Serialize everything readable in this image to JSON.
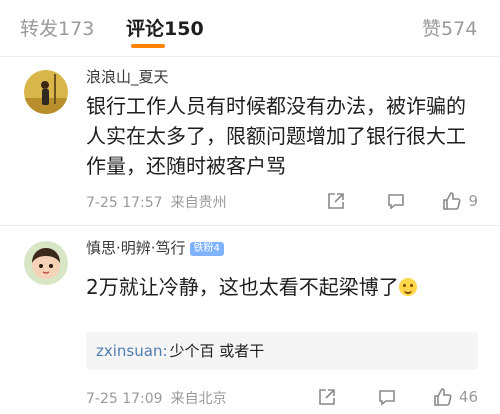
{
  "tabs": [
    {
      "label": "转发",
      "count": "173",
      "active": false
    },
    {
      "label": "评论",
      "count": "150",
      "active": true
    },
    {
      "label": "赞",
      "count": "574",
      "active": false
    }
  ],
  "comments": [
    {
      "username": "浪浪山_夏天",
      "text": "银行工作人员有时候都没有办法，被诈骗的人实在太多了，限额问题增加了银行很大工作量，还随时被客户骂",
      "time": "7-25 17:57",
      "location": "来自贵州",
      "likes": "9"
    },
    {
      "username": "慎思·明辨·笃行",
      "badge": "铁粉4",
      "text": "2万就让冷静，这也太看不起梁博了",
      "time": "7-25 17:09",
      "location": "来自北京",
      "likes": "46",
      "reply": {
        "user": "zxinsuan:",
        "text": "少个百 或者干"
      }
    }
  ],
  "icons": {
    "share": "share-icon",
    "reply": "comment-icon",
    "like": "thumbs-up-icon"
  },
  "colors": {
    "accent": "#ff8200",
    "link": "#507daf",
    "muted": "#9a9a9a"
  }
}
